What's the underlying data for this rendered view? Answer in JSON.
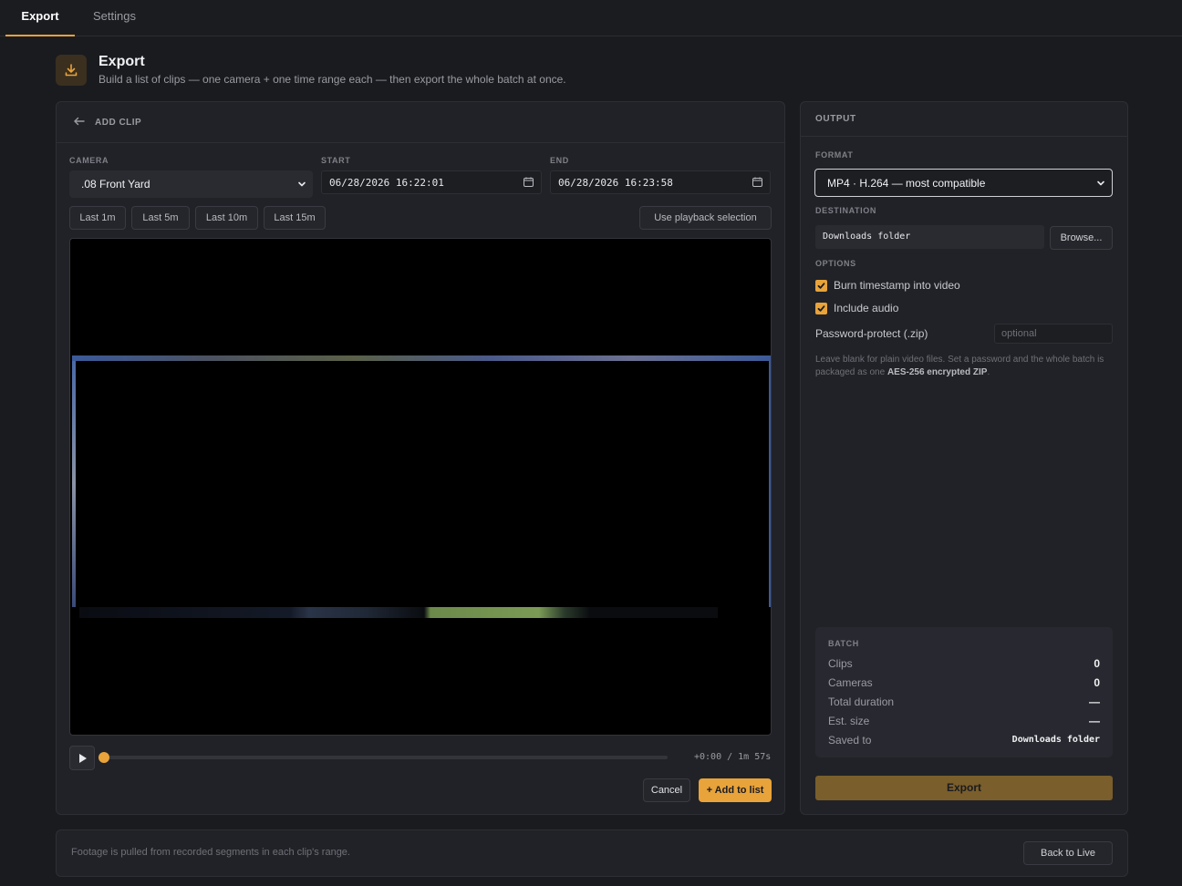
{
  "nav": {
    "tabs": [
      {
        "label": "Export"
      },
      {
        "label": "Settings"
      }
    ]
  },
  "header": {
    "title": "Export",
    "subtitle": "Build a list of clips — one camera + one time range each — then export the whole batch at once."
  },
  "add_clip": {
    "back_icon": "arrow-left-icon",
    "title": "ADD CLIP",
    "camera_label": "CAMERA",
    "camera_value": ".08 Front Yard",
    "start_label": "START",
    "start_value": "06/28/2026 16:22:01",
    "end_label": "END",
    "end_value": "06/28/2026 16:23:58",
    "quick_ranges": [
      "Last 1m",
      "Last 5m",
      "Last 10m",
      "Last 15m"
    ],
    "use_selection_label": "Use playback selection",
    "player": {
      "time_readout": "+0:00 / 1m 57s",
      "progress_fraction": 0
    },
    "cancel_label": "Cancel",
    "add_label": "+ Add to list"
  },
  "output": {
    "title": "OUTPUT",
    "format_label": "FORMAT",
    "format_value": "MP4 · H.264 — most compatible",
    "destination_label": "DESTINATION",
    "destination_value": "Downloads folder",
    "browse_label": "Browse...",
    "options_label": "OPTIONS",
    "burn_timestamp_label": "Burn timestamp into video",
    "burn_timestamp_checked": true,
    "include_audio_label": "Include audio",
    "include_audio_checked": true,
    "password_label": "Password-protect (.zip)",
    "password_placeholder": "optional",
    "password_help_pre": "Leave blank for plain video files. Set a password and the whole batch is packaged as one ",
    "password_help_bold": "AES-256 encrypted ZIP",
    "password_help_post": ".",
    "batch": {
      "title": "BATCH",
      "rows": [
        {
          "key": "Clips",
          "value": "0"
        },
        {
          "key": "Cameras",
          "value": "0"
        },
        {
          "key": "Total duration",
          "value": "—"
        },
        {
          "key": "Est. size",
          "value": "—"
        },
        {
          "key": "Saved to",
          "value": "Downloads folder"
        }
      ]
    },
    "export_label": "Export"
  },
  "footer": {
    "note": "Footage is pulled from recorded segments in each clip's range.",
    "back_live_label": "Back to Live"
  },
  "colors": {
    "accent": "#e8a33a",
    "background": "#1a1b1f",
    "panel": "#212227"
  }
}
